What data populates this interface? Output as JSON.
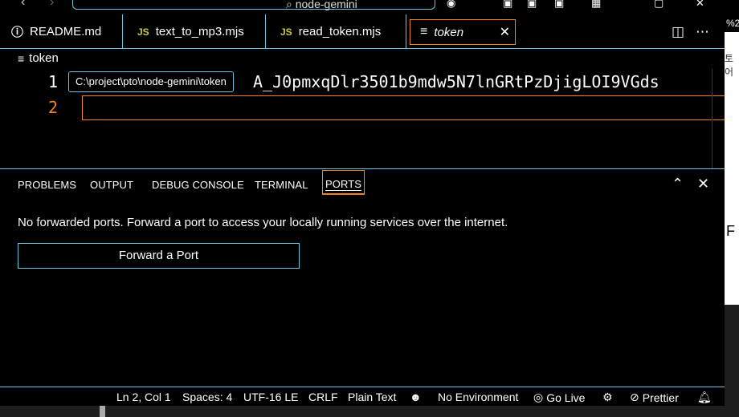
{
  "titlebar": {
    "search_text": "node-gemini"
  },
  "tabs": [
    {
      "label": "README.md",
      "icon": "info-icon",
      "icon_glyph": "ⓘ",
      "icon_color": "#4fc1ff"
    },
    {
      "label": "text_to_mp3.mjs",
      "icon": "js-file-icon",
      "icon_glyph": "JS",
      "icon_color": "#cbcb41"
    },
    {
      "label": "read_token.mjs",
      "icon": "js-file-icon",
      "icon_glyph": "JS",
      "icon_color": "#cbcb41"
    },
    {
      "label": "token",
      "icon": "plaintext-file-icon",
      "icon_glyph": "≡",
      "icon_color": "#ffffff",
      "active": true
    }
  ],
  "breadcrumb": {
    "file": "token"
  },
  "editor": {
    "lines": [
      {
        "number": "1",
        "text": "A_J0pmxqDlr3501b9mdw5N7lnGRtPzDjigLOI9VGds"
      },
      {
        "number": "2",
        "text": ""
      }
    ],
    "tooltip": "C:\\project\\pto\\node-gemini\\token",
    "line_number_color": "#ffffff",
    "active_line_number_color": "#f38518"
  },
  "panel": {
    "tabs": [
      "PROBLEMS",
      "OUTPUT",
      "DEBUG CONSOLE",
      "TERMINAL",
      "PORTS"
    ],
    "active_tab": "PORTS",
    "message": "No forwarded ports. Forward a port to access your locally running services over the internet.",
    "button_label": "Forward a Port"
  },
  "statusbar": {
    "position": "Ln 2, Col 1",
    "spaces": "Spaces: 4",
    "encoding": "UTF-16 LE",
    "eol": "CRLF",
    "language": "Plain Text",
    "environment": "No Environment",
    "golive": "Go Live",
    "prettier": "Prettier"
  },
  "right_strip": {
    "text1": "%2",
    "text2": "토어",
    "text3": "F"
  },
  "colors": {
    "accent_border": "#6fc3df",
    "active_border": "#f38518",
    "background": "#000000"
  }
}
